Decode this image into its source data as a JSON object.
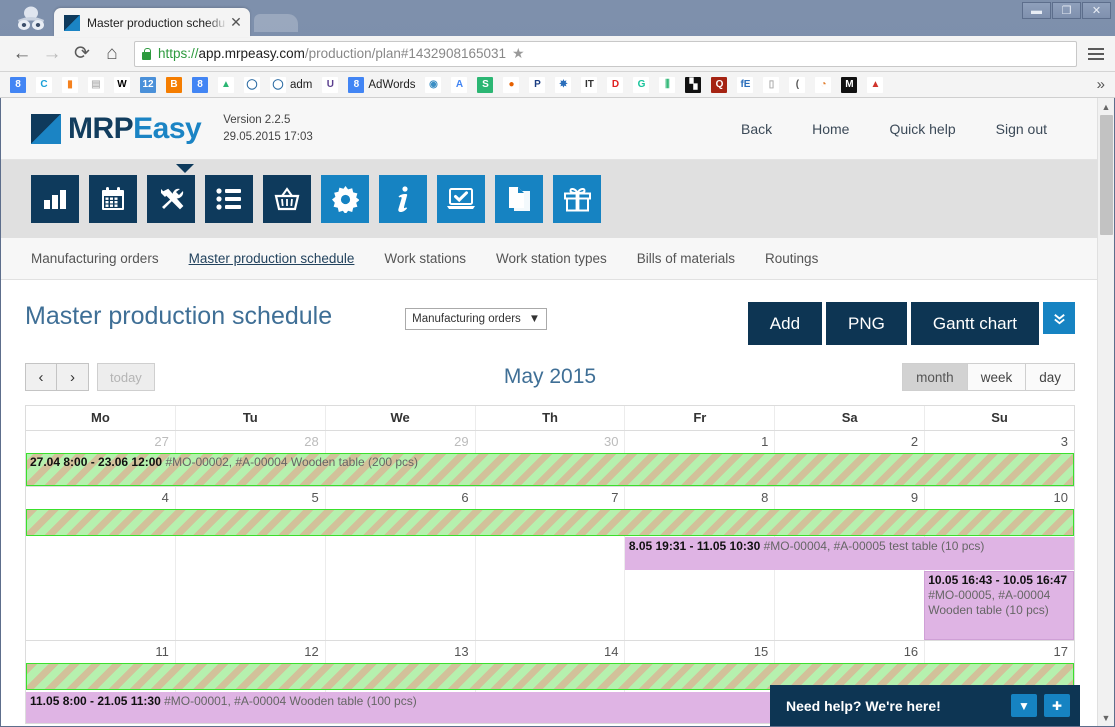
{
  "browser": {
    "tab_title": "Master production schedu",
    "tab_close": "✕",
    "back_icon": "←",
    "forward_icon": "→",
    "reload_icon": "⟳",
    "home_icon": "⌂",
    "url_scheme": "https://",
    "url_host": "app.mrpeasy.com",
    "url_path": "/production/plan#1432908165031",
    "star_icon": "★",
    "minimize": "▬",
    "maximize": "❐",
    "close": "✕",
    "bookmarks_more": "»",
    "bookmarks": [
      {
        "name": "google-plus-bookmark",
        "label": "",
        "glyph": "8",
        "bg": "#4285f4",
        "fg": "#ffffff"
      },
      {
        "name": "chrome-bookmark",
        "label": "",
        "glyph": "C",
        "bg": "#ffffff",
        "fg": "#1aa0d8"
      },
      {
        "name": "analytics-bookmark",
        "label": "",
        "glyph": "▮",
        "bg": "#ffffff",
        "fg": "#f5821f"
      },
      {
        "name": "doc-bookmark",
        "label": "",
        "glyph": "▤",
        "bg": "#ffffff",
        "fg": "#bbbbbb"
      },
      {
        "name": "wikipedia-bookmark",
        "label": "",
        "glyph": "W",
        "bg": "#ffffff",
        "fg": "#000000"
      },
      {
        "name": "calendar-bookmark",
        "label": "",
        "glyph": "12",
        "bg": "#4a90d9",
        "fg": "#ffffff"
      },
      {
        "name": "blogger-bookmark",
        "label": "",
        "glyph": "B",
        "bg": "#f57d00",
        "fg": "#ffffff"
      },
      {
        "name": "google-bookmark",
        "label": "",
        "glyph": "8",
        "bg": "#4285f4",
        "fg": "#ffffff"
      },
      {
        "name": "drive-bookmark",
        "label": "",
        "glyph": "▲",
        "bg": "#ffffff",
        "fg": "#2bb673"
      },
      {
        "name": "chat-bookmark",
        "label": "",
        "glyph": "◯",
        "bg": "#ffffff",
        "fg": "#2e6da4"
      },
      {
        "name": "adm-bookmark",
        "label": "adm",
        "glyph": "◯",
        "bg": "#ffffff",
        "fg": "#2e6da4"
      },
      {
        "name": "upwork-bookmark",
        "label": "",
        "glyph": "U",
        "bg": "#ffffff",
        "fg": "#5a3e8e"
      },
      {
        "name": "adwords-bookmark",
        "label": "AdWords",
        "glyph": "8",
        "bg": "#4285f4",
        "fg": "#ffffff"
      },
      {
        "name": "globe-bookmark",
        "label": "",
        "glyph": "◉",
        "bg": "#ffffff",
        "fg": "#3a8ec4"
      },
      {
        "name": "translate-bookmark",
        "label": "",
        "glyph": "A",
        "bg": "#ffffff",
        "fg": "#4285f4"
      },
      {
        "name": "sheets-bookmark",
        "label": "",
        "glyph": "S",
        "bg": "#2bb673",
        "fg": "#ffffff"
      },
      {
        "name": "firefox-bookmark",
        "label": "",
        "glyph": "●",
        "bg": "#ffffff",
        "fg": "#e66000"
      },
      {
        "name": "paypal-bookmark",
        "label": "",
        "glyph": "P",
        "bg": "#ffffff",
        "fg": "#1a3d82"
      },
      {
        "name": "asterisk-bookmark",
        "label": "",
        "glyph": "✸",
        "bg": "#ffffff",
        "fg": "#2a6ebb"
      },
      {
        "name": "itbt-bookmark",
        "label": "",
        "glyph": "IT",
        "bg": "#ffffff",
        "fg": "#333333"
      },
      {
        "name": "d-bookmark",
        "label": "",
        "glyph": "D",
        "bg": "#ffffff",
        "fg": "#e02020"
      },
      {
        "name": "grammarly-bookmark",
        "label": "",
        "glyph": "G",
        "bg": "#ffffff",
        "fg": "#15c39a"
      },
      {
        "name": "chart-bookmark",
        "label": "",
        "glyph": "⫼",
        "bg": "#ffffff",
        "fg": "#2bb673"
      },
      {
        "name": "flag-bookmark",
        "label": "",
        "glyph": "▚",
        "bg": "#111111",
        "fg": "#ffffff"
      },
      {
        "name": "q-bookmark",
        "label": "",
        "glyph": "Q",
        "bg": "#a52312",
        "fg": "#ffffff"
      },
      {
        "name": "fe-bookmark",
        "label": "",
        "glyph": "fE",
        "bg": "#ffffff",
        "fg": "#2a6ebb"
      },
      {
        "name": "page-bookmark",
        "label": "",
        "glyph": "▯",
        "bg": "#ffffff",
        "fg": "#aaaaaa"
      },
      {
        "name": "bracket-bookmark",
        "label": "",
        "glyph": "(",
        "bg": "#ffffff",
        "fg": "#555555"
      },
      {
        "name": "pie-bookmark",
        "label": "",
        "glyph": "◔",
        "bg": "#ffffff",
        "fg": "#e07b2a"
      },
      {
        "name": "mail-bookmark",
        "label": "",
        "glyph": "M",
        "bg": "#111111",
        "fg": "#ffffff"
      },
      {
        "name": "rocket-bookmark",
        "label": "",
        "glyph": "▲",
        "bg": "#ffffff",
        "fg": "#d0342c"
      }
    ]
  },
  "brand": {
    "logo_mrp": "MRP",
    "logo_easy": "Easy",
    "version_line1": "Version 2.2.5",
    "version_line2": "29.05.2015 17:03",
    "nav": [
      {
        "name": "back-link",
        "label": "Back"
      },
      {
        "name": "home-link",
        "label": "Home"
      },
      {
        "name": "quick-help-link",
        "label": "Quick help"
      },
      {
        "name": "sign-out-link",
        "label": "Sign out"
      }
    ]
  },
  "app_icons": [
    {
      "name": "dashboard-icon",
      "glyph": "bars",
      "style": "dark"
    },
    {
      "name": "calendar-icon",
      "glyph": "calendar",
      "style": "dark"
    },
    {
      "name": "production-icon",
      "glyph": "tools",
      "style": "dark"
    },
    {
      "name": "list-icon",
      "glyph": "list",
      "style": "dark"
    },
    {
      "name": "procurement-icon",
      "glyph": "basket",
      "style": "dark"
    },
    {
      "name": "settings-icon",
      "glyph": "gear",
      "style": "light"
    },
    {
      "name": "info-icon",
      "glyph": "info",
      "style": "light"
    },
    {
      "name": "crm-icon",
      "glyph": "laptop-check",
      "style": "light"
    },
    {
      "name": "documents-icon",
      "glyph": "pages",
      "style": "light"
    },
    {
      "name": "gift-icon",
      "glyph": "gift",
      "style": "light"
    }
  ],
  "subnav": [
    {
      "name": "subnav-manufacturing-orders",
      "label": "Manufacturing orders",
      "active": false
    },
    {
      "name": "subnav-master-production-schedule",
      "label": "Master production schedule",
      "active": true
    },
    {
      "name": "subnav-work-stations",
      "label": "Work stations",
      "active": false
    },
    {
      "name": "subnav-work-station-types",
      "label": "Work station types",
      "active": false
    },
    {
      "name": "subnav-bills-of-materials",
      "label": "Bills of materials",
      "active": false
    },
    {
      "name": "subnav-routings",
      "label": "Routings",
      "active": false
    }
  ],
  "main": {
    "page_title": "Master production schedule",
    "view_select_value": "Manufacturing orders",
    "view_select_caret": "▼",
    "buttons": {
      "add": "Add",
      "png": "PNG",
      "gantt": "Gantt chart",
      "expand_icon": "»"
    },
    "nav": {
      "prev_icon": "‹",
      "next_icon": "›",
      "today": "today",
      "month_label": "May 2015",
      "views": [
        {
          "name": "view-month",
          "label": "month",
          "selected": true
        },
        {
          "name": "view-week",
          "label": "week",
          "selected": false
        },
        {
          "name": "view-day",
          "label": "day",
          "selected": false
        }
      ]
    }
  },
  "calendar": {
    "weekday_headers": [
      "Mo",
      "Tu",
      "We",
      "Th",
      "Fr",
      "Sa",
      "Su"
    ],
    "weeks": [
      {
        "days": [
          {
            "num": "27",
            "other": true
          },
          {
            "num": "28",
            "other": true
          },
          {
            "num": "29",
            "other": true
          },
          {
            "num": "30",
            "other": true
          },
          {
            "num": "1",
            "other": false
          },
          {
            "num": "2",
            "other": false
          },
          {
            "num": "3",
            "other": false
          }
        ]
      },
      {
        "days": [
          {
            "num": "4",
            "other": false
          },
          {
            "num": "5",
            "other": false
          },
          {
            "num": "6",
            "other": false
          },
          {
            "num": "7",
            "other": false
          },
          {
            "num": "8",
            "other": false
          },
          {
            "num": "9",
            "other": false
          },
          {
            "num": "10",
            "other": false
          }
        ]
      },
      {
        "days": [
          {
            "num": "11",
            "other": false
          },
          {
            "num": "12",
            "other": false
          },
          {
            "num": "13",
            "other": false
          },
          {
            "num": "14",
            "other": false
          },
          {
            "num": "15",
            "other": false
          },
          {
            "num": "16",
            "other": false
          },
          {
            "num": "17",
            "other": false
          }
        ]
      }
    ],
    "events": {
      "mo2_time": "27.04 8:00 - 23.06 12:00 ",
      "mo2_desc": "#MO-00002, #A-00004 Wooden table (200 pcs)",
      "mo4_time": "8.05 19:31 - 11.05 10:30 ",
      "mo4_desc": "#MO-00004, #A-00005 test table (10 pcs)",
      "mo5_time": "10.05 16:43 - 10.05 16:47 ",
      "mo5_desc": "#MO-00005, #A-00004 Wooden table (10 pcs)",
      "mo1_time": "11.05 8:00 - 21.05 11:30 ",
      "mo1_desc": "#MO-00001, #A-00004 Wooden table (100 pcs)"
    }
  },
  "chat": {
    "message": "Need help? We're here!",
    "minimize_icon": "▼",
    "expand_icon": "✚"
  },
  "scrollbar": {
    "up_icon": "▲",
    "down_icon": "▼"
  },
  "colors": {
    "brand_dark": "#0d3553",
    "brand_light": "#1683c2",
    "title_blue": "#3f6f96",
    "event_green_bg": "#b6f0ae",
    "event_green_border": "#3ae02c",
    "event_purple": "#dfb4e4"
  }
}
